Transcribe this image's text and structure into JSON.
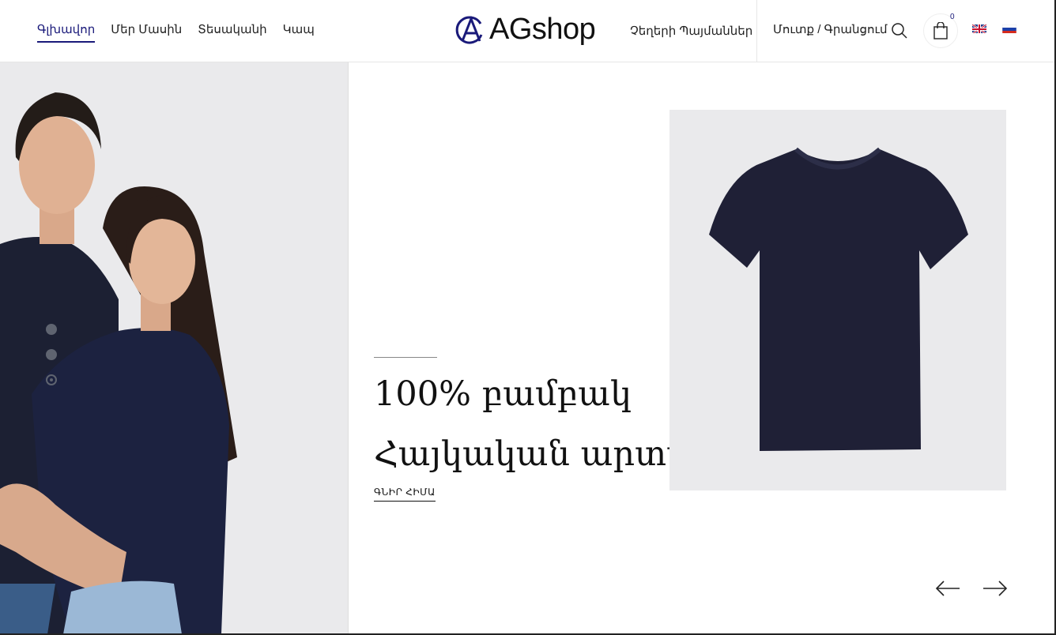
{
  "header": {
    "nav": [
      {
        "label": "Գլխավոր",
        "active": true
      },
      {
        "label": "Մեր Մասին",
        "active": false
      },
      {
        "label": "Տեսականի",
        "active": false
      },
      {
        "label": "Կապ",
        "active": false
      }
    ],
    "logo_text": "AGshop",
    "sizes_link": "Չեղերի Պայմաններ",
    "login_link": "Մուտք / Գրանցում",
    "cart_count": "0",
    "languages": [
      "en-flag-icon",
      "ru-flag-icon"
    ]
  },
  "hero": {
    "slide_dots": 3,
    "active_dot": 3,
    "title_line_1": "100% բամբակ",
    "title_line_2": "Հայկական արտադրություն",
    "buy_link": "ԳՆԻՐ ՀԻՄԱ"
  },
  "colors": {
    "accent": "#1a1a7a",
    "hero_bg": "#eaeaec",
    "shirt": "#1f2036"
  },
  "icons": {
    "search": "search-icon",
    "cart": "shopping-bag-icon",
    "prev": "arrow-left-icon",
    "next": "arrow-right-icon"
  }
}
